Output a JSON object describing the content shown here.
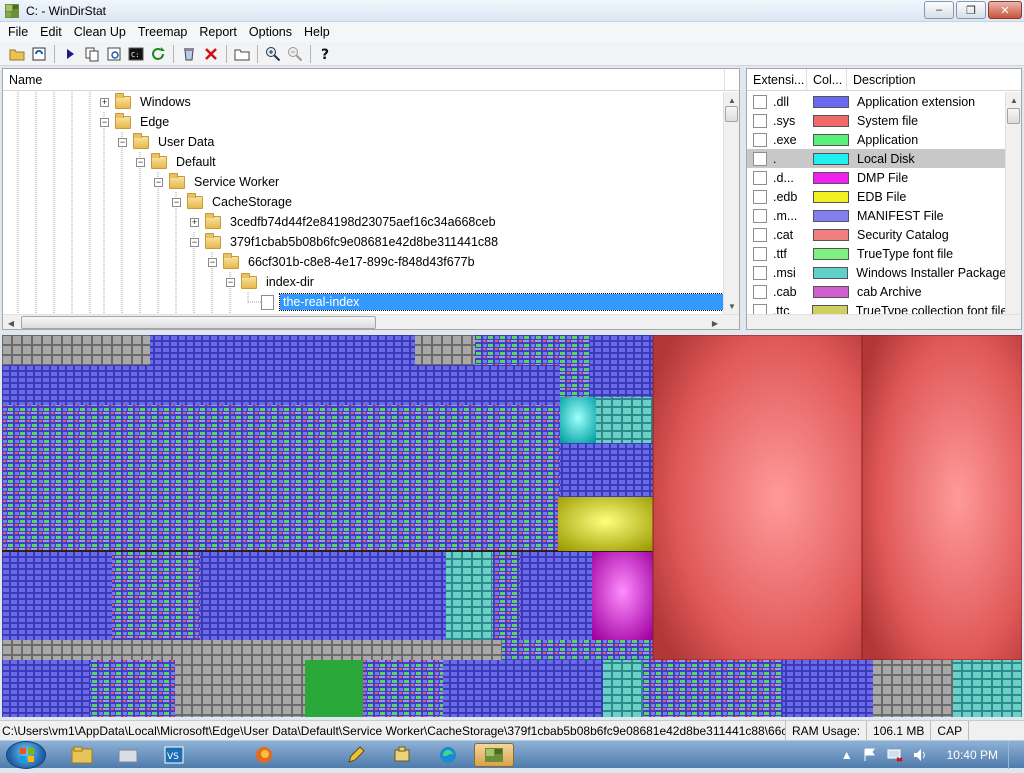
{
  "window": {
    "title": "C: - WinDirStat",
    "minimize": "‒",
    "maximize": "❐",
    "close": "✕"
  },
  "menu": [
    "File",
    "Edit",
    "Clean Up",
    "Treemap",
    "Report",
    "Options",
    "Help"
  ],
  "toolbar": {
    "icons": [
      "open-icon",
      "refresh-all-icon",
      "copy-path-icon",
      "explorer-icon",
      "command-prompt-icon",
      "refresh-icon",
      "recycle-icon",
      "delete-icon",
      "properties-icon",
      "zoom-in-icon",
      "zoom-out-icon",
      "help-icon"
    ]
  },
  "tree": {
    "header": "Name",
    "rows": [
      {
        "label": "Windows",
        "type": "folder",
        "expander": "+",
        "level": 0
      },
      {
        "label": "Edge",
        "type": "folder",
        "expander": "−",
        "level": 0
      },
      {
        "label": "User Data",
        "type": "folder",
        "expander": "−",
        "level": 1
      },
      {
        "label": "Default",
        "type": "folder",
        "expander": "−",
        "level": 2
      },
      {
        "label": "Service Worker",
        "type": "folder",
        "expander": "−",
        "level": 3
      },
      {
        "label": "CacheStorage",
        "type": "folder",
        "expander": "−",
        "level": 4
      },
      {
        "label": "3cedfb74d44f2e84198d23075aef16c34a668ceb",
        "type": "folder",
        "expander": "+",
        "level": 5
      },
      {
        "label": "379f1cbab5b08b6fc9e08681e42d8be311441c88",
        "type": "folder",
        "expander": "−",
        "level": 5
      },
      {
        "label": "66cf301b-c8e8-4e17-899c-f848d43f677b",
        "type": "folder",
        "expander": "−",
        "level": 6
      },
      {
        "label": "index-dir",
        "type": "folder",
        "expander": "−",
        "level": 7
      },
      {
        "label": "the-real-index",
        "type": "file",
        "expander": "",
        "level": 8,
        "selected": true
      }
    ]
  },
  "extensions": {
    "headers": [
      "Extensi...",
      "Col...",
      "Description"
    ],
    "rows": [
      {
        "ext": ".dll",
        "color": "#6a6af0",
        "desc": "Application extension"
      },
      {
        "ext": ".sys",
        "color": "#f06a6a",
        "desc": "System file"
      },
      {
        "ext": ".exe",
        "color": "#5af07a",
        "desc": "Application"
      },
      {
        "ext": ".",
        "color": "#20f0f0",
        "desc": "Local Disk",
        "highlight": true
      },
      {
        "ext": ".d...",
        "color": "#f020f0",
        "desc": "DMP File"
      },
      {
        "ext": ".edb",
        "color": "#f0f020",
        "desc": "EDB File"
      },
      {
        "ext": ".m...",
        "color": "#8080f0",
        "desc": "MANIFEST File"
      },
      {
        "ext": ".cat",
        "color": "#f08080",
        "desc": "Security Catalog"
      },
      {
        "ext": ".ttf",
        "color": "#80f080",
        "desc": "TrueType font file"
      },
      {
        "ext": ".msi",
        "color": "#60d0c8",
        "desc": "Windows Installer Package"
      },
      {
        "ext": ".cab",
        "color": "#d060d0",
        "desc": "cab Archive"
      },
      {
        "ext": ".ttc",
        "color": "#d0d060",
        "desc": "TrueType collection font file"
      }
    ]
  },
  "status": {
    "path": "C:\\Users\\vm1\\AppData\\Local\\Microsoft\\Edge\\User Data\\Default\\Service Worker\\CacheStorage\\379f1cbab5b08b6fc9e08681e42d8be311441c88\\66cf3(",
    "ram_label": "RAM Usage:",
    "ram_value": "106.1 MB",
    "cap": "CAP"
  },
  "taskbar": {
    "clock": "10:40 PM",
    "apps": [
      "explorer-icon",
      "folder-icon",
      "vs-icon",
      "firefox-icon",
      "pencil-icon",
      "puzzle-icon",
      "edge-icon",
      "windirstat-icon"
    ]
  }
}
